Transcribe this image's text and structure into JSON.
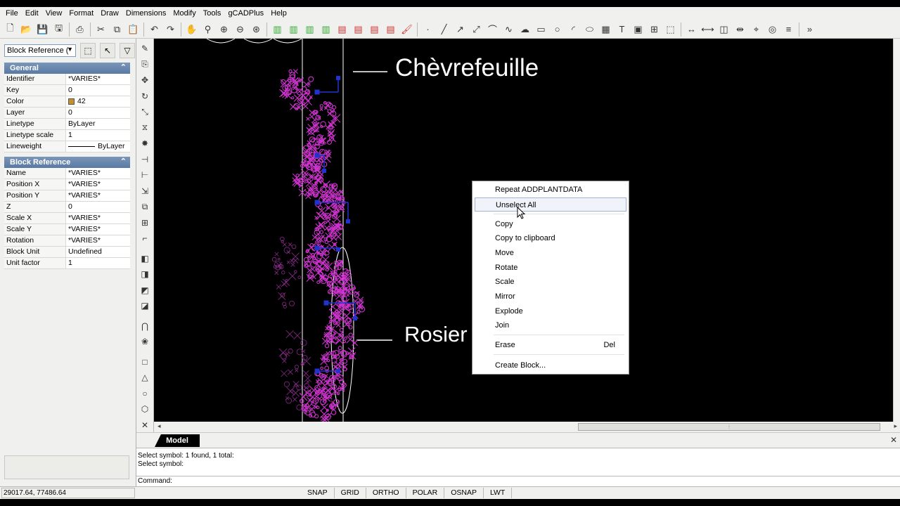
{
  "menubar": [
    "File",
    "Edit",
    "View",
    "Format",
    "Draw",
    "Dimensions",
    "Modify",
    "Tools",
    "gCADPlus",
    "Help"
  ],
  "toolbar": {
    "groups": [
      [
        "new-icon",
        "open-icon",
        "save-as-icon",
        "save-icon"
      ],
      [
        "print-icon"
      ],
      [
        "cut-icon",
        "copy-icon",
        "paste-icon"
      ],
      [
        "undo-icon",
        "redo-icon"
      ],
      [
        "pan-icon",
        "zoom-realtime-icon",
        "zoom-window-icon",
        "zoom-out-icon",
        "zoom-extents-icon"
      ],
      [
        "layers-icon",
        "layer-states-icon",
        "linetype-icon",
        "lineweight-icon",
        "text-style-icon",
        "dim-style-icon",
        "table-style-icon",
        "multileader-style-icon",
        "match-properties-icon"
      ],
      [
        "point-icon",
        "line-icon",
        "ray-icon",
        "xline-icon",
        "polyline-icon",
        "spline-icon",
        "revcloud-icon",
        "rectangle-icon",
        "circle-icon",
        "arc-icon",
        "ellipse-icon",
        "hatch-icon",
        "text-icon",
        "block-icon",
        "insert-icon",
        "region-icon"
      ],
      [
        "dimension-icon",
        "measure-icon",
        "area-icon",
        "distance-icon",
        "locate-icon",
        "id-icon",
        "list-icon"
      ],
      [
        "toolbar-options-icon"
      ]
    ]
  },
  "properties": {
    "selection": "Block Reference (",
    "general_title": "General",
    "general": [
      {
        "key": "Identifier",
        "value": "*VARIES*"
      },
      {
        "key": "Key",
        "value": "0"
      },
      {
        "key": "Color",
        "value": "42",
        "swatch": "#c8902a"
      },
      {
        "key": "Layer",
        "value": "0"
      },
      {
        "key": "Linetype",
        "value": "ByLayer"
      },
      {
        "key": "Linetype scale",
        "value": "1"
      },
      {
        "key": "Lineweight",
        "value": "ByLayer",
        "line": true
      }
    ],
    "block_title": "Block Reference",
    "block": [
      {
        "key": "Name",
        "value": "*VARIES*"
      },
      {
        "key": "Position X",
        "value": "*VARIES*"
      },
      {
        "key": "Position Y",
        "value": "*VARIES*"
      },
      {
        "key": "Z",
        "value": "0"
      },
      {
        "key": "Scale X",
        "value": "*VARIES*"
      },
      {
        "key": "Scale Y",
        "value": "*VARIES*"
      },
      {
        "key": "Rotation",
        "value": "*VARIES*"
      },
      {
        "key": "Block Unit",
        "value": "Undefined"
      },
      {
        "key": "Unit factor",
        "value": "1"
      }
    ]
  },
  "left_tools": [
    "erase-icon",
    "copy-object-icon",
    "move-icon",
    "rotate-icon",
    "scale-icon",
    "mirror-icon",
    "explode-icon",
    "trim-icon",
    "extend-icon",
    "stretch-icon",
    "offset-icon",
    "array-icon",
    "fillet-icon",
    "bring-front-icon",
    "send-back-icon",
    "bring-above-icon",
    "send-under-icon",
    "magnet-icon",
    "plants-icon",
    "square-icon",
    "triangle-icon",
    "circle-shape-icon",
    "polygon-shape-icon",
    "cross-icon",
    "ucs-icon"
  ],
  "canvas": {
    "labels": {
      "chevrefeuille": "Chèvrefeuille",
      "rosier": "Rosier"
    },
    "colors": {
      "plants": "#cc33cc",
      "grips": "#2233cc",
      "lines": "#ffffff"
    }
  },
  "context_menu": {
    "items": [
      {
        "label": "Repeat ADDPLANTDATA"
      },
      {
        "label": "Unselect All",
        "hover": true
      },
      {
        "label": "Copy"
      },
      {
        "label": "Copy to clipboard"
      },
      {
        "label": "Move"
      },
      {
        "label": "Rotate"
      },
      {
        "label": "Scale"
      },
      {
        "label": "Mirror"
      },
      {
        "label": "Explode"
      },
      {
        "label": "Join"
      },
      {
        "label": "Erase",
        "shortcut": "Del"
      },
      {
        "label": "Create Block..."
      }
    ]
  },
  "tab": {
    "model": "Model"
  },
  "command": {
    "history": [
      "Select symbol: 1 found, 1 total:",
      "Select symbol:"
    ],
    "prompt": "Command:"
  },
  "status": {
    "coords": "29017.64,  77486.64",
    "toggles": [
      "SNAP",
      "GRID",
      "ORTHO",
      "POLAR",
      "OSNAP",
      "LWT"
    ]
  }
}
